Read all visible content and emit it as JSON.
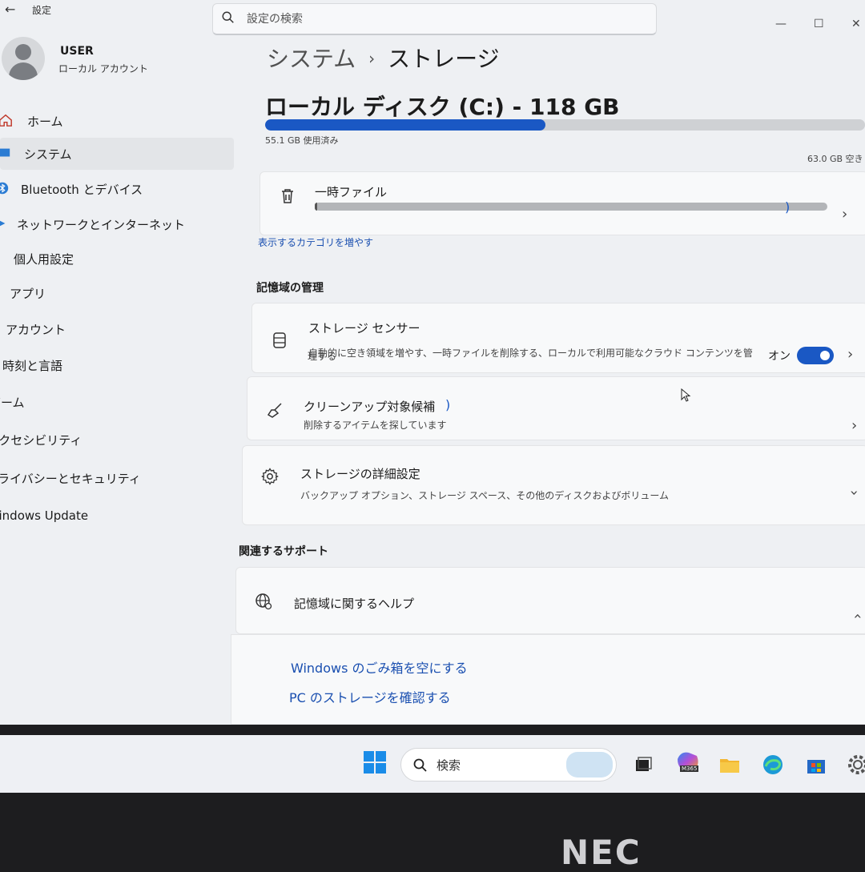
{
  "window": {
    "back_glyph": "←",
    "app_title": "設定",
    "search_placeholder": "設定の検索",
    "controls": {
      "minimize": "—",
      "maximize": "☐",
      "close": "✕"
    }
  },
  "user": {
    "name": "USER",
    "account_type": "ローカル アカウント"
  },
  "sidebar": {
    "items": [
      {
        "label": "ホーム",
        "icon": "home-icon"
      },
      {
        "label": "システム",
        "icon": "system-icon",
        "active": true
      },
      {
        "label": "Bluetooth とデバイス",
        "icon": "bluetooth-icon"
      },
      {
        "label": "ネットワークとインターネット",
        "icon": "network-icon"
      },
      {
        "label": "個人用設定",
        "icon": "personalize-icon"
      },
      {
        "label": "アプリ",
        "icon": "apps-icon"
      },
      {
        "label": "アカウント",
        "icon": "account-icon"
      },
      {
        "label": "時刻と言語",
        "icon": "time-icon"
      },
      {
        "label": "ゲーム",
        "icon": "game-icon"
      },
      {
        "label": "アクセシビリティ",
        "icon": "accessibility-icon"
      },
      {
        "label": "プライバシーとセキュリティ",
        "icon": "privacy-icon"
      },
      {
        "label": "Windows Update",
        "icon": "update-icon"
      }
    ]
  },
  "breadcrumb": {
    "parent": "システム",
    "separator": "›",
    "current": "ストレージ"
  },
  "disk": {
    "title": "ローカル ディスク (C:) - 118 GB",
    "used_label": "55.1 GB 使用済み",
    "free_label": "63.0 GB 空き",
    "used_fraction": 0.467
  },
  "temp_files": {
    "label": "一時ファイル",
    "loading_glyph": ")"
  },
  "show_more_link": "表示するカテゴリを増やす",
  "storage_management": {
    "heading": "記憶域の管理",
    "sense": {
      "title": "ストレージ センサー",
      "desc_line1": "自動的に空き領域を増やす、一時ファイルを削除する、ローカルで利用可能なクラウド コンテンツを管",
      "desc_line2": "理する",
      "toggle_label": "オン",
      "toggle_on": true
    },
    "cleanup": {
      "title": "クリーンアップ対象候補",
      "loading_glyph": ")",
      "desc": "削除するアイテムを探しています"
    },
    "advanced": {
      "title": "ストレージの詳細設定",
      "desc": "バックアップ オプション、ストレージ スペース、その他のディスクおよびボリューム"
    }
  },
  "related_support": {
    "heading": "関連するサポート",
    "help_title": "記憶域に関するヘルプ",
    "links": [
      "Windows のごみ箱を空にする",
      "PC のストレージを確認する"
    ]
  },
  "taskbar": {
    "search_label": "検索",
    "m365_badge": "M365"
  },
  "bezel_logo": "NEC",
  "colors": {
    "accent": "#1a58c4",
    "link": "#1a4fb0",
    "background": "#eef0f3"
  }
}
